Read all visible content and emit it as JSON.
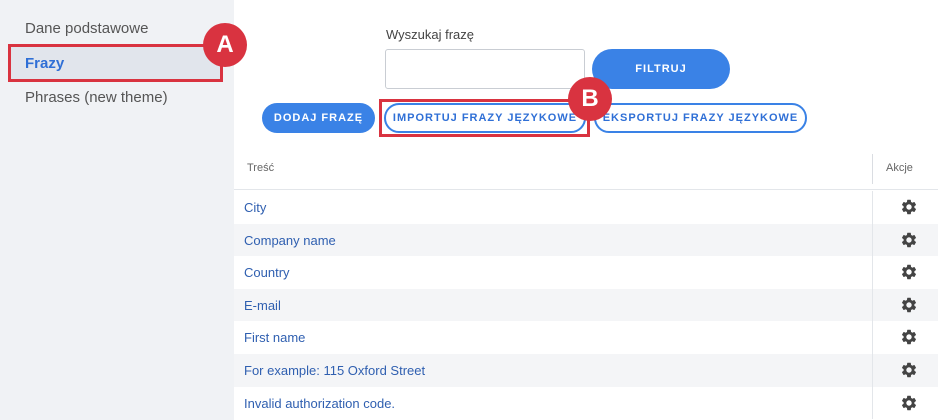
{
  "sidebar": {
    "items": [
      {
        "label": "Dane podstawowe"
      },
      {
        "label": "Frazy"
      },
      {
        "label": "Phrases (new theme)"
      }
    ]
  },
  "markers": {
    "a": "A",
    "b": "B"
  },
  "search": {
    "label": "Wyszukaj frazę",
    "value": "",
    "filter_label": "FILTRUJ"
  },
  "toolbar": {
    "add_label": "DODAJ FRAZĘ",
    "import_label": "IMPORTUJ FRAZY JĘZYKOWE",
    "export_label": "EKSPORTUJ FRAZY JĘZYKOWE"
  },
  "table": {
    "headers": {
      "content": "Treść",
      "actions": "Akcje"
    },
    "rows": [
      "City",
      "Company name",
      "Country",
      "E-mail",
      "First name",
      "For example: 115 Oxford Street",
      "Invalid authorization code."
    ],
    "action_icon": "gear-icon"
  },
  "colors": {
    "accent": "#3a82e6",
    "highlight": "#d93340",
    "link": "#2f5fb0",
    "sidebar_bg": "#f0f2f5"
  }
}
